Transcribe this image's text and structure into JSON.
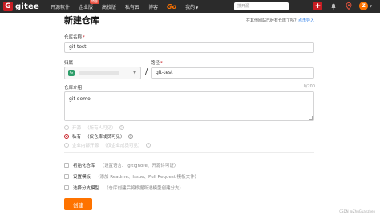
{
  "topbar": {
    "logo_mark": "G",
    "logo_text": "gitee",
    "nav": [
      "开源软件",
      "企业版",
      "高校版",
      "私有云",
      "博客"
    ],
    "enterprise_badge": "特惠",
    "go_label": "Go",
    "more_label": "我的",
    "search_placeholder": "搜开源",
    "plus_icon": "+",
    "avatar_letter": "Z"
  },
  "page": {
    "title": "新建仓库",
    "import_hint": "在其他网站已经有仓库了吗？",
    "import_link": "点击导入"
  },
  "form": {
    "repo_name_label": "仓库名称",
    "repo_name_value": "git-test",
    "owner_label": "归属",
    "owner_avatar_letter": "G",
    "path_label": "路径",
    "path_value": "git-test",
    "slash": "/",
    "desc_label": "仓库介绍",
    "desc_counter": "0/200",
    "desc_value": "git demo",
    "required_mark": "*"
  },
  "visibility": {
    "options": [
      {
        "label": "开源",
        "sub": "（所有人可见）",
        "checked": false,
        "disabled": true
      },
      {
        "label": "私有",
        "sub": "（仅仓库成员可见）",
        "checked": true,
        "disabled": false
      },
      {
        "label": "企业内部开源",
        "sub": "（仅企业成员可见）",
        "checked": false,
        "disabled": true
      }
    ],
    "help_icon": "?"
  },
  "options": [
    {
      "label": "初始化仓库",
      "sub": "（设置语言、.gitignore、开源许可证）"
    },
    {
      "label": "设置模板",
      "sub": "（添加 Readme、Issue、Pull Request 模板文件）"
    },
    {
      "label": "选择分支模型",
      "sub": "（仓库创建后将根据所选模型创建分支）"
    }
  ],
  "actions": {
    "create_label": "创建"
  },
  "watermark": "CSDN @ZhuGuanzhen"
}
